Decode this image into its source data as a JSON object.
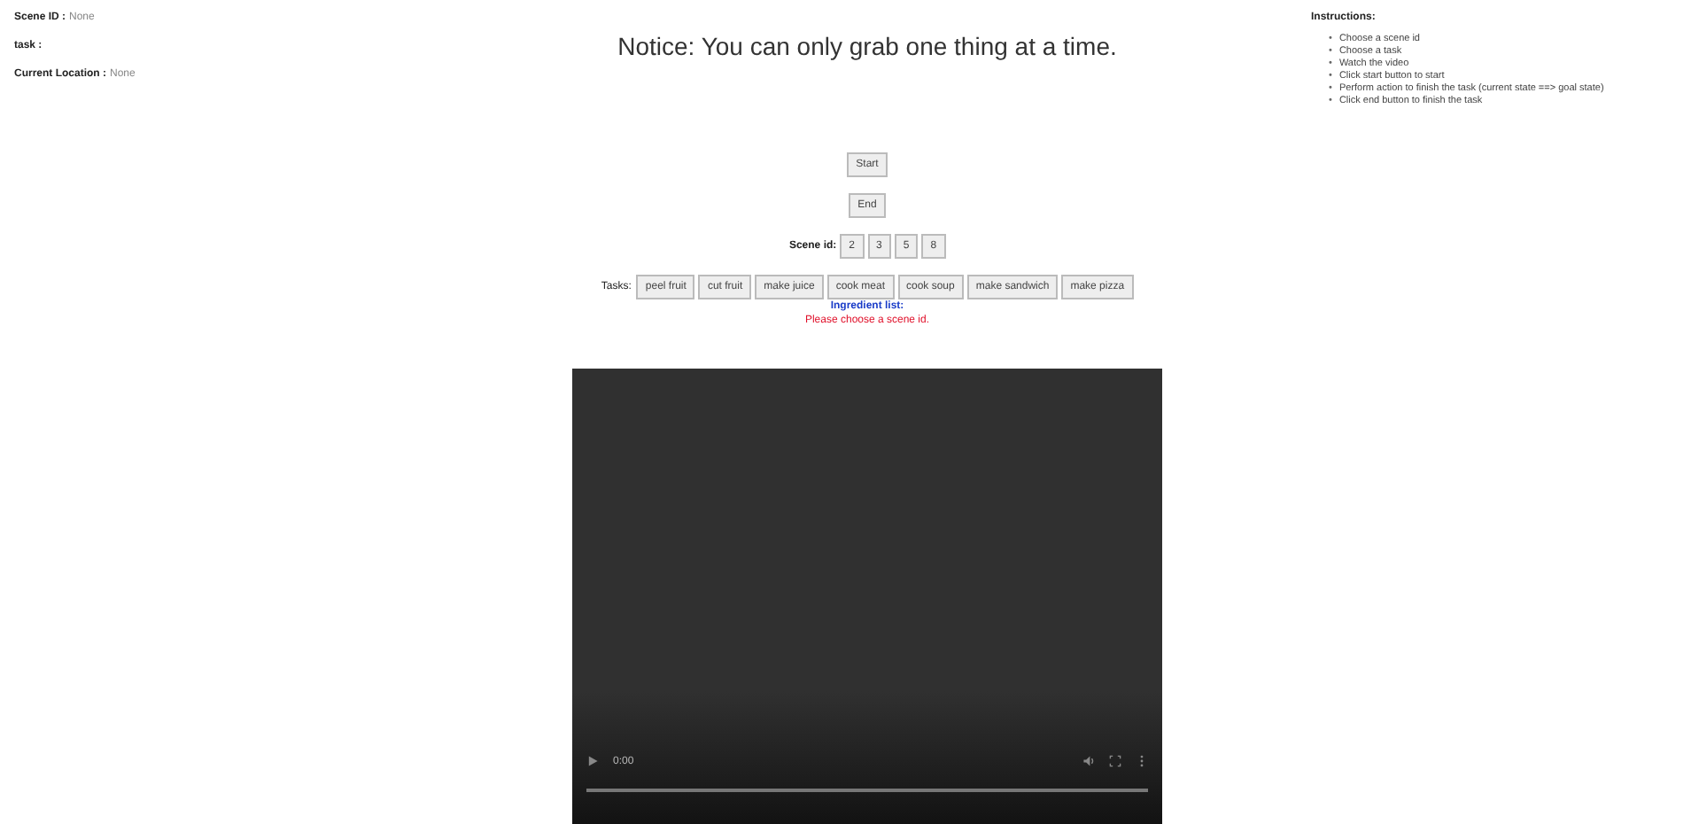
{
  "info": [
    {
      "label": "Scene ID :",
      "value": "None"
    },
    {
      "label": "task :"
    },
    {
      "label": "Current Location :",
      "value": "None"
    }
  ],
  "notice": "Notice: You can only grab one thing at a time.",
  "buttons": [
    "Start",
    "End"
  ],
  "scene_ids": {
    "label": "Scene id:",
    "options": [
      "2",
      "3",
      "5",
      "8"
    ]
  },
  "tasks": {
    "label": "Tasks:",
    "options": [
      "peel fruit",
      "cut fruit",
      "make juice",
      "cook meat",
      "cook soup",
      "make sandwich",
      "make pizza"
    ]
  },
  "ingredient_list": "Ingredient list:",
  "message": "Please choose a scene id.",
  "video": {
    "time": "0:00"
  },
  "instructions": {
    "title": "Instructions:",
    "marker": "•",
    "items": [
      "Choose a scene id",
      "Choose a task",
      "Watch the video",
      "Click start button to start",
      "Perform action to finish the task (current state ==> goal state)",
      "Click end button to finish the task"
    ]
  }
}
